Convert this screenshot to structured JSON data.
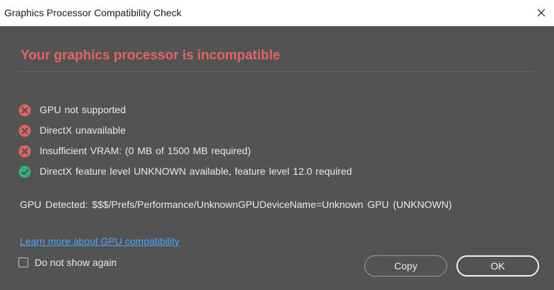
{
  "window": {
    "title": "Graphics Processor Compatibility Check",
    "close_icon": "close-icon"
  },
  "main": {
    "heading": "Your graphics processor is incompatible",
    "checks": [
      {
        "status": "fail",
        "icon": "error-icon",
        "label": "GPU not supported"
      },
      {
        "status": "fail",
        "icon": "error-icon",
        "label": "DirectX unavailable"
      },
      {
        "status": "fail",
        "icon": "error-icon",
        "label": "Insufficient VRAM: (0 MB of 1500 MB required)"
      },
      {
        "status": "pass",
        "icon": "success-icon",
        "label": "DirectX feature level UNKNOWN available, feature level 12.0 required"
      }
    ],
    "gpu_detected": "GPU Detected: $$$/Prefs/Performance/UnknownGPUDeviceName=Unknown GPU (UNKNOWN)",
    "learn_more_link": "Learn more about GPU compatibility"
  },
  "footer": {
    "dont_show_label": "Do not show again",
    "dont_show_checked": false,
    "copy_label": "Copy",
    "ok_label": "OK"
  },
  "colors": {
    "background": "#535353",
    "heading": "#e06464",
    "error": "#e06464",
    "success": "#2fb37c",
    "link": "#4fa3f7"
  }
}
